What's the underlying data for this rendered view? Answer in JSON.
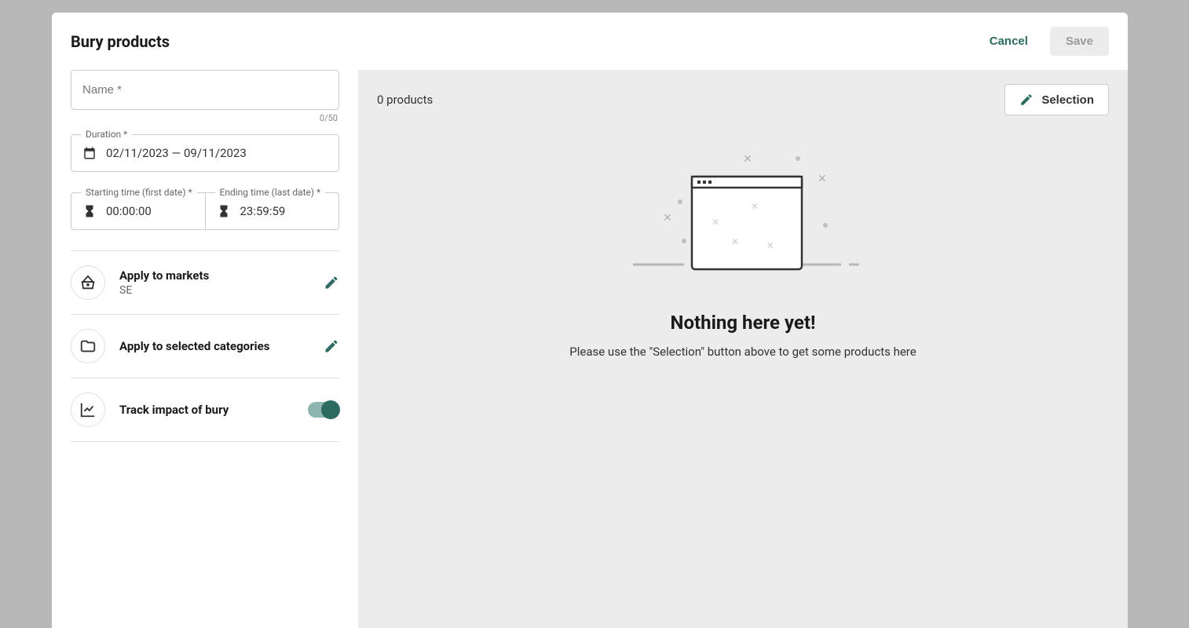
{
  "modal": {
    "title": "Bury products",
    "cancel_label": "Cancel",
    "save_label": "Save"
  },
  "form": {
    "name_placeholder": "Name *",
    "name_value": "",
    "char_count": "0/50",
    "duration_label": "Duration *",
    "duration_value": "02/11/2023 — 09/11/2023",
    "start_time_label": "Starting time (first date) *",
    "start_time_value": "00:00:00",
    "end_time_label": "Ending time (last date) *",
    "end_time_value": "23:59:59"
  },
  "settings": {
    "markets": {
      "title": "Apply to markets",
      "value": "SE"
    },
    "categories": {
      "title": "Apply to selected categories"
    },
    "track": {
      "title": "Track impact of bury",
      "enabled": true
    }
  },
  "right": {
    "product_count": "0 products",
    "selection_label": "Selection",
    "empty_title": "Nothing here yet!",
    "empty_subtitle": "Please use the \"Selection\" button above to get some products here"
  }
}
